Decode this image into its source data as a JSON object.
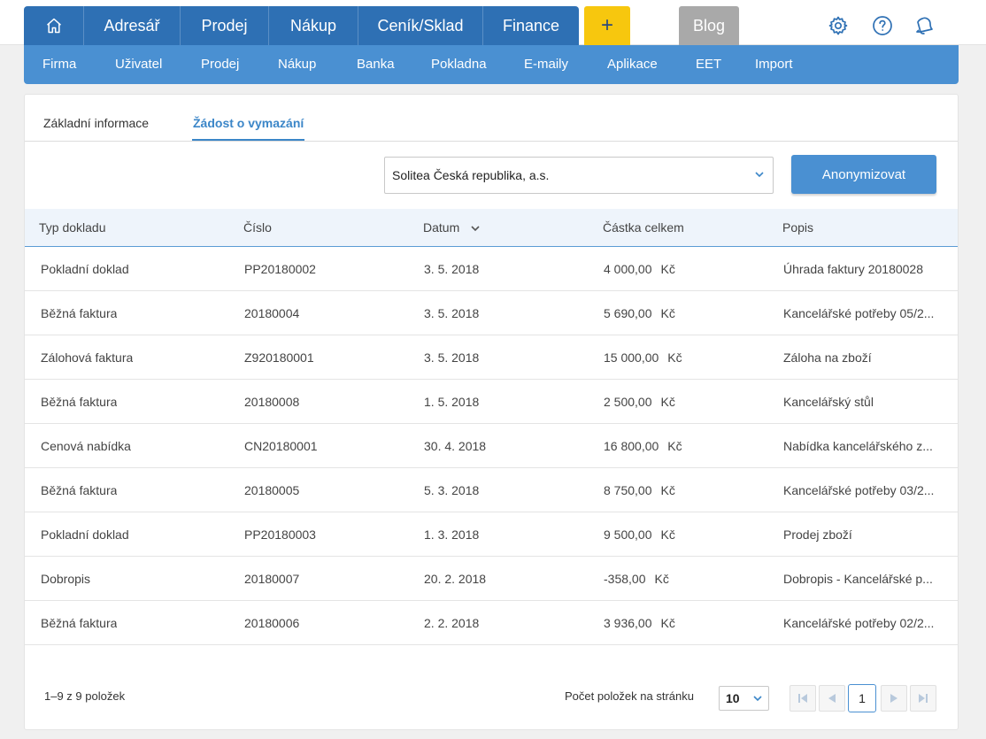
{
  "main_nav": {
    "items": [
      "Adresář",
      "Prodej",
      "Nákup",
      "Ceník/Sklad",
      "Finance"
    ],
    "plus_label": "+",
    "blog_label": "Blog"
  },
  "sub_nav": {
    "items": [
      "Firma",
      "Uživatel",
      "Prodej",
      "Nákup",
      "Banka",
      "Pokladna",
      "E-maily",
      "Aplikace",
      "EET",
      "Import"
    ]
  },
  "tabs": {
    "basic": "Základní informace",
    "delete_request": "Žádost o vymazání"
  },
  "company_select": {
    "value": "Solitea Česká republika, a.s."
  },
  "anonymize_button": "Anonymizovat",
  "table": {
    "columns": [
      "Typ dokladu",
      "Číslo",
      "Datum",
      "Částka celkem",
      "Popis"
    ],
    "rows": [
      {
        "type": "Pokladní doklad",
        "number": "PP20180002",
        "date": "3. 5. 2018",
        "amount": "4 000,00",
        "currency": "Kč",
        "desc": "Úhrada faktury 20180028"
      },
      {
        "type": "Běžná faktura",
        "number": "20180004",
        "date": "3. 5. 2018",
        "amount": "5 690,00",
        "currency": "Kč",
        "desc": "Kancelářské potřeby 05/2..."
      },
      {
        "type": "Zálohová faktura",
        "number": "Z920180001",
        "date": "3. 5. 2018",
        "amount": "15 000,00",
        "currency": "Kč",
        "desc": "Záloha na zboží"
      },
      {
        "type": "Běžná faktura",
        "number": "20180008",
        "date": "1. 5. 2018",
        "amount": "2 500,00",
        "currency": "Kč",
        "desc": "Kancelářský stůl"
      },
      {
        "type": "Cenová nabídka",
        "number": "CN20180001",
        "date": "30. 4. 2018",
        "amount": "16 800,00",
        "currency": "Kč",
        "desc": "Nabídka kancelářského z..."
      },
      {
        "type": "Běžná faktura",
        "number": "20180005",
        "date": "5. 3. 2018",
        "amount": "8 750,00",
        "currency": "Kč",
        "desc": "Kancelářské potřeby 03/2..."
      },
      {
        "type": "Pokladní doklad",
        "number": "PP20180003",
        "date": "1. 3. 2018",
        "amount": "9 500,00",
        "currency": "Kč",
        "desc": "Prodej zboží"
      },
      {
        "type": "Dobropis",
        "number": "20180007",
        "date": "20. 2. 2018",
        "amount": "-358,00",
        "currency": "Kč",
        "desc": "Dobropis - Kancelářské p..."
      },
      {
        "type": "Běžná faktura",
        "number": "20180006",
        "date": "2. 2. 2018",
        "amount": "3 936,00",
        "currency": "Kč",
        "desc": "Kancelářské potřeby 02/2..."
      }
    ]
  },
  "footer": {
    "count": "1–9 z 9 položek",
    "per_page_label": "Počet položek na stránku",
    "per_page_value": "10",
    "current_page": "1"
  },
  "colors": {
    "main_nav": "#2e70b4",
    "sub_nav": "#4a90d2",
    "accent_yellow": "#f7c70e",
    "blog_grey": "#a9a9a9"
  },
  "icons": [
    "home-icon",
    "settings-gear-icon",
    "help-icon",
    "notification-bell-icon",
    "chevron-down-icon",
    "sort-desc-icon",
    "first-page-icon",
    "prev-page-icon",
    "next-page-icon",
    "last-page-icon"
  ]
}
